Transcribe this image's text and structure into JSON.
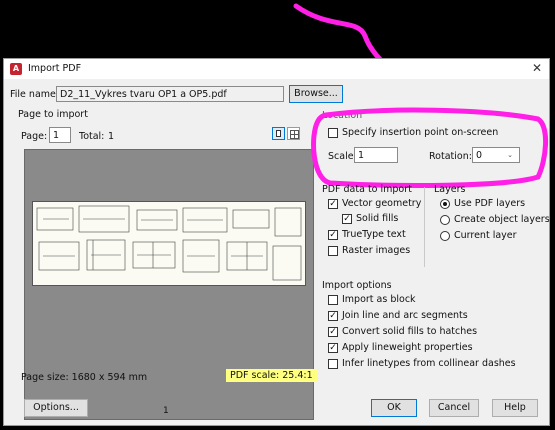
{
  "window": {
    "title": "Import PDF",
    "close_glyph": "✕"
  },
  "file": {
    "label": "File name:",
    "value": "D2_11_Vykres tvaru OP1 a OP5.pdf",
    "browse_label": "Browse..."
  },
  "page_to_import": {
    "heading": "Page to import",
    "page_label": "Page:",
    "page_value": "1",
    "total_label": "Total:",
    "total_value": "1",
    "view_single_icon": "single-page-view-icon",
    "view_grid_icon": "grid-view-icon",
    "thumb_page_number": "1"
  },
  "location": {
    "heading": "Location",
    "specify_insertion_label": "Specify insertion point on-screen",
    "specify_insertion_checked": false,
    "scale_label": "Scale:",
    "scale_value": "1",
    "rotation_label": "Rotation:",
    "rotation_value": "0"
  },
  "pdf_data": {
    "heading": "PDF data to import",
    "items": [
      {
        "label": "Vector geometry",
        "checked": true
      },
      {
        "label": "Solid fills",
        "checked": true
      },
      {
        "label": "TrueType text",
        "checked": true
      },
      {
        "label": "Raster images",
        "checked": false
      }
    ]
  },
  "layers": {
    "heading": "Layers",
    "options": [
      {
        "label": "Use PDF layers",
        "selected": true
      },
      {
        "label": "Create object layers",
        "selected": false
      },
      {
        "label": "Current layer",
        "selected": false
      }
    ]
  },
  "import_options": {
    "heading": "Import options",
    "items": [
      {
        "label": "Import as block",
        "checked": false
      },
      {
        "label": "Join line and arc segments",
        "checked": true
      },
      {
        "label": "Convert solid fills to hatches",
        "checked": true
      },
      {
        "label": "Apply lineweight properties",
        "checked": true
      },
      {
        "label": "Infer linetypes from collinear dashes",
        "checked": false
      }
    ]
  },
  "footer": {
    "page_size": "Page size: 1680 x 594 mm",
    "pdf_scale": "PDF scale: 25.4:1",
    "options_label": "Options...",
    "ok_label": "OK",
    "cancel_label": "Cancel",
    "help_label": "Help"
  },
  "colors": {
    "annotation": "#ff1fe6",
    "highlight": "#ffff80",
    "accent": "#0078d7"
  }
}
